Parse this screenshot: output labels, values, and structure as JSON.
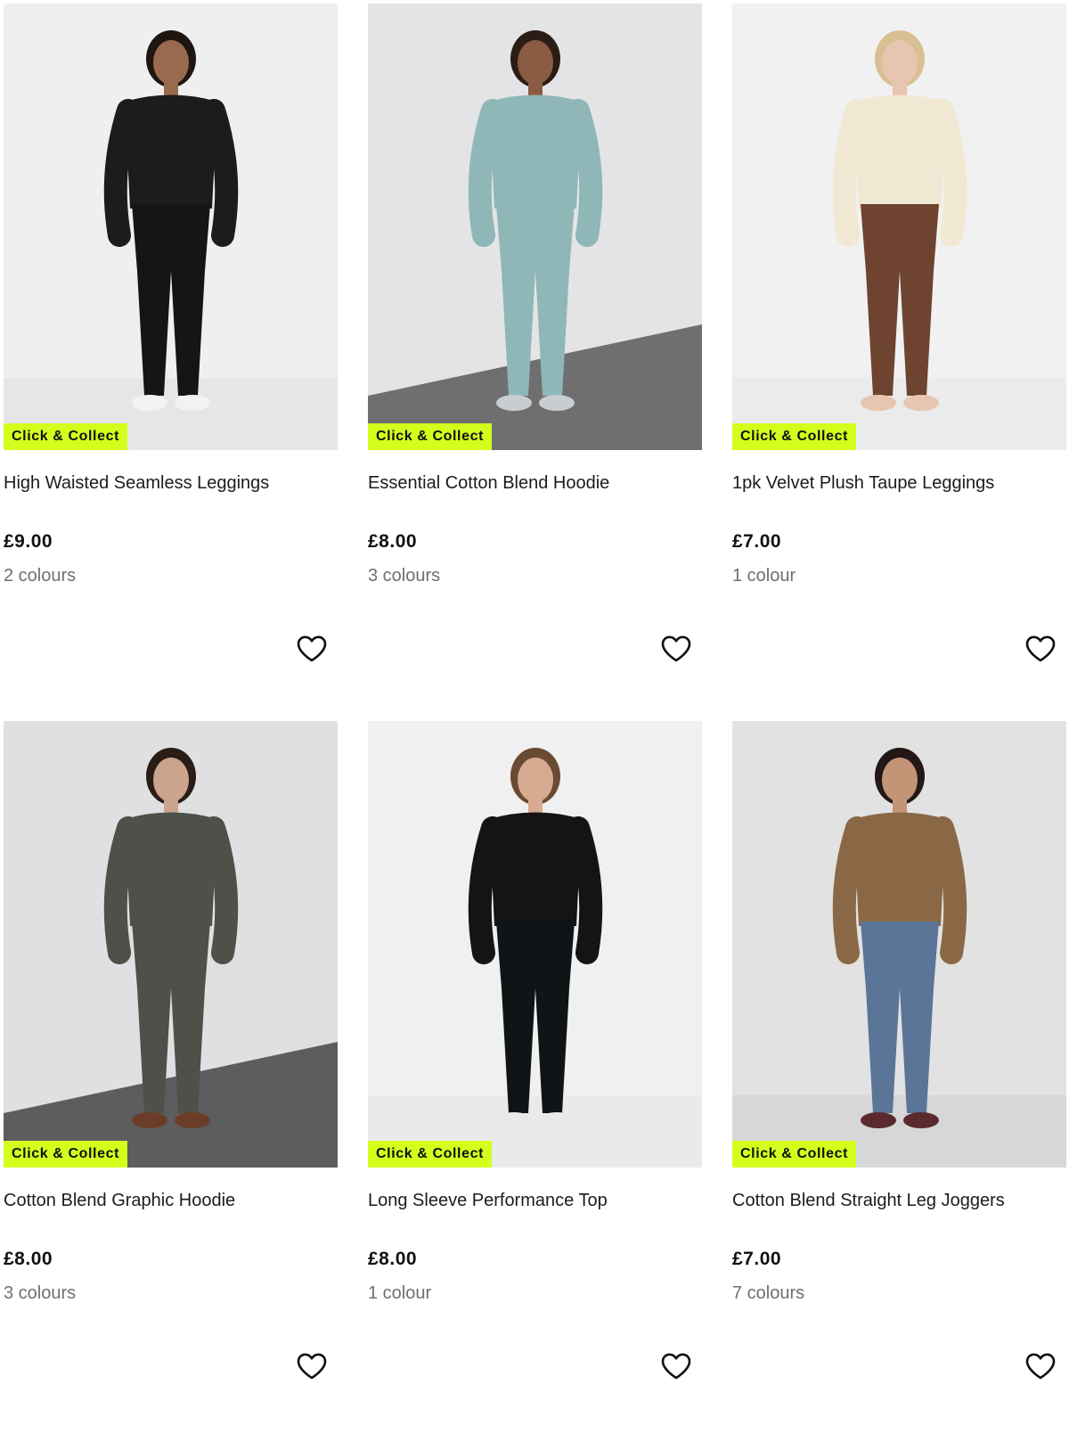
{
  "products": [
    {
      "badge": "Click & Collect",
      "title": "High Waisted Seamless Leggings",
      "price": "£9.00",
      "colours": "2 colours",
      "icon": "heart-outline-icon",
      "palette": {
        "bg": "#efefef",
        "floor": "#e6e6e6",
        "skin": "#9a6a4e",
        "top": "#1c1c1c",
        "bottom": "#151515",
        "shoe": "#f2f2f2",
        "hair": "#1f1511"
      }
    },
    {
      "badge": "Click & Collect",
      "title": "Essential Cotton Blend Hoodie",
      "price": "£8.00",
      "colours": "3 colours",
      "icon": "heart-outline-icon",
      "palette": {
        "bg": "#e4e4e6",
        "floor": "#6f6f6f",
        "skin": "#8a5c43",
        "top": "#8fb7b7",
        "bottom": "#8fb7b7",
        "shoe": "#c9ccd0",
        "hair": "#2b1d16"
      }
    },
    {
      "badge": "Click & Collect",
      "title": "1pk Velvet Plush Taupe Leggings",
      "price": "£7.00",
      "colours": "1 colour",
      "icon": "heart-outline-icon",
      "palette": {
        "bg": "#f1f1f1",
        "floor": "#ebebeb",
        "skin": "#e7c5b0",
        "top": "#f1e8d3",
        "bottom": "#6e4330",
        "shoe": "#e7c5b0",
        "hair": "#d9bf94"
      }
    },
    {
      "badge": "Click & Collect",
      "title": "Cotton Blend Graphic Hoodie",
      "price": "£8.00",
      "colours": "3 colours",
      "icon": "heart-outline-icon",
      "palette": {
        "bg": "#e0e0e2",
        "floor": "#5d5d5f",
        "skin": "#caa48c",
        "top": "#4e5149",
        "bottom": "#4e5149",
        "shoe": "#6b3d28",
        "hair": "#2a1c16"
      }
    },
    {
      "badge": "Click & Collect",
      "title": "Long Sleeve Performance Top",
      "price": "£8.00",
      "colours": "1 colour",
      "icon": "heart-outline-icon",
      "palette": {
        "bg": "#f0f0f0",
        "floor": "#eaeaea",
        "skin": "#d7ab91",
        "top": "#141414",
        "bottom": "#0f1416",
        "shoe": "#e9e9e9",
        "hair": "#6b4a33"
      }
    },
    {
      "badge": "Click & Collect",
      "title": "Cotton Blend Straight Leg Joggers",
      "price": "£7.00",
      "colours": "7 colours",
      "icon": "heart-outline-icon",
      "palette": {
        "bg": "#e2e2e2",
        "floor": "#d7d7d7",
        "skin": "#c49477",
        "top": "#8a6846",
        "bottom": "#5a7598",
        "shoe": "#5b2a2e",
        "hair": "#231815"
      }
    }
  ]
}
